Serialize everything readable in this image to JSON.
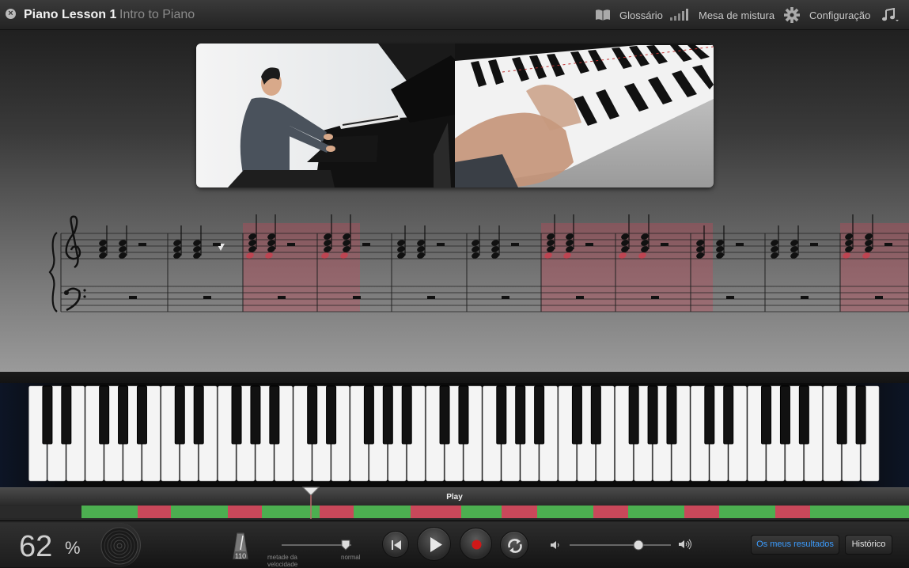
{
  "header": {
    "title": "Piano Lesson 1",
    "subtitle": "Intro to Piano",
    "glossary": "Glossário",
    "mixer": "Mesa de mistura",
    "settings": "Configuração"
  },
  "progress": {
    "label": "Play",
    "segments": [
      "green",
      "red",
      "green",
      "red",
      "green",
      "red",
      "green",
      "red",
      "green",
      "red",
      "green",
      "red",
      "green",
      "red",
      "green",
      "red",
      "green"
    ]
  },
  "controls": {
    "score_value": "62",
    "score_unit": "%",
    "tempo": "110",
    "half_speed": "metade da velocidade",
    "normal": "normal",
    "results_button": "Os meus resultados",
    "history_button": "Histórico",
    "speed_level": 0.92,
    "volume_level": 0.68
  },
  "colors": {
    "accent": "#3b9cff",
    "record": "#d01818",
    "correct": "#4caf50",
    "wrong": "#c9485a"
  }
}
